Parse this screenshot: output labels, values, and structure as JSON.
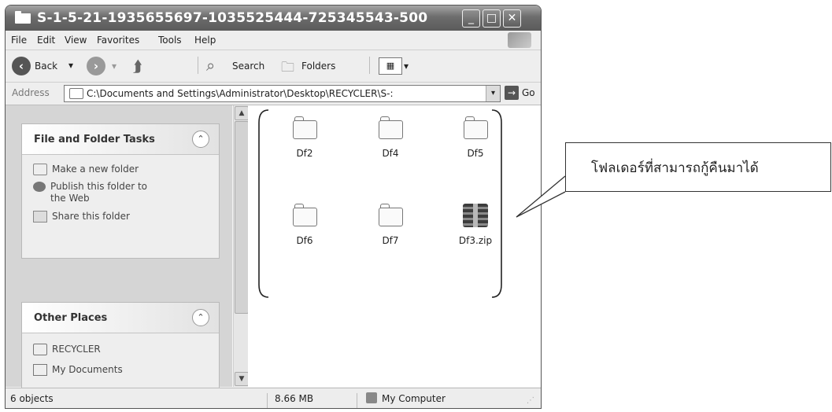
{
  "window": {
    "title": "S-1-5-21-1935655697-1035525444-725345543-500"
  },
  "menu": {
    "items": [
      "File",
      "Edit",
      "View",
      "Favorites",
      "Tools",
      "Help"
    ]
  },
  "toolbar": {
    "back": "Back",
    "search": "Search",
    "folders": "Folders"
  },
  "address": {
    "label": "Address",
    "value": "C:\\Documents and Settings\\Administrator\\Desktop\\RECYCLER\\S-:",
    "go": "Go"
  },
  "tasks": {
    "title": "File and Folder Tasks",
    "items": [
      "Make a new folder",
      "Publish this folder to",
      "the Web",
      "Share this folder"
    ]
  },
  "places": {
    "title": "Other Places",
    "items": [
      "RECYCLER",
      "My Documents"
    ]
  },
  "files": [
    {
      "name": "Df2",
      "type": "folder"
    },
    {
      "name": "Df4",
      "type": "folder"
    },
    {
      "name": "Df5",
      "type": "folder"
    },
    {
      "name": "Df6",
      "type": "folder"
    },
    {
      "name": "Df7",
      "type": "folder"
    },
    {
      "name": "Df3.zip",
      "type": "zip"
    }
  ],
  "status": {
    "count": "6 objects",
    "size": "8.66 MB",
    "location": "My Computer"
  },
  "callout": {
    "text": "โฟลเดอร์ที่สามารถกู้คืนมาได้"
  }
}
